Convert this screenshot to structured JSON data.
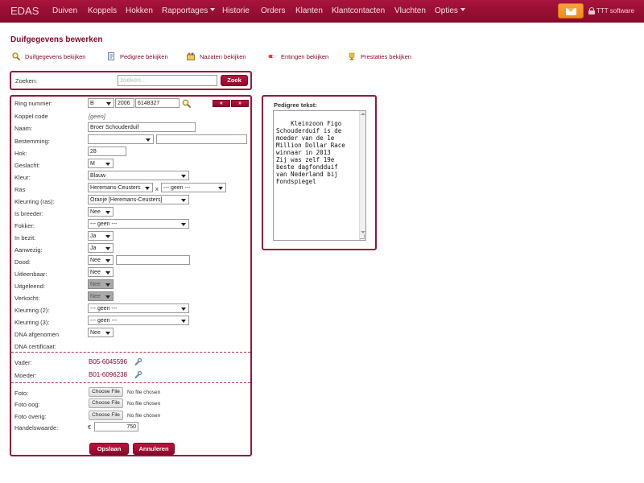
{
  "app": {
    "brand": "EDAS"
  },
  "nav": {
    "items": [
      {
        "label": "Duiven"
      },
      {
        "label": "Koppels"
      },
      {
        "label": "Hokken"
      },
      {
        "label": "Rapportages"
      },
      {
        "label": "Historie"
      },
      {
        "label": "Orders"
      },
      {
        "label": "Klanten"
      },
      {
        "label": "Klantcontacten"
      },
      {
        "label": "Vluchten"
      },
      {
        "label": "Opties"
      }
    ],
    "user": "TTT software"
  },
  "page": {
    "title": "Duifgegevens bewerken",
    "actions": [
      {
        "label": "Duifgegevens bekijken",
        "icon": "magnifier-icon"
      },
      {
        "label": "Pedigree bekijken",
        "icon": "document-icon"
      },
      {
        "label": "Nazaten bekijken",
        "icon": "family-icon"
      },
      {
        "label": "Entingen bekijken",
        "icon": "pill-icon"
      },
      {
        "label": "Prestaties bekijken",
        "icon": "trophy-icon"
      }
    ]
  },
  "search": {
    "label": "Zoeken:",
    "placeholder": "zoeken...",
    "button": "Zoek"
  },
  "form": {
    "ring": {
      "label": "Ring nummer:",
      "country": "B",
      "year": "2006",
      "number": "6148327",
      "prev": "«",
      "next": "»"
    },
    "koppel": {
      "label": "Koppel code",
      "value": "[geen]"
    },
    "naam": {
      "label": "Naam:",
      "value": "Broer Schouderduif"
    },
    "bestemming": {
      "label": "Bestemming:",
      "value": "",
      "extra": ""
    },
    "hok": {
      "label": "Hok:",
      "value": "28"
    },
    "geslacht": {
      "label": "Geslacht:",
      "value": "M"
    },
    "kleur": {
      "label": "Kleur:",
      "value": "Blauw"
    },
    "ras": {
      "label": "Ras",
      "value": "Heremans-Ceusters",
      "sep": "x",
      "value2": "--- geen ---"
    },
    "kleurring_ras": {
      "label": "Kleurring (ras):",
      "value": "Oranje [Heremans-Ceusters]"
    },
    "is_breeder": {
      "label": "Is breeder:",
      "value": "Nee"
    },
    "fokker": {
      "label": "Fokker:",
      "value": "--- geen ---"
    },
    "in_bezit": {
      "label": "In bezit:",
      "value": "Ja"
    },
    "aanwezig": {
      "label": "Aanwezig:",
      "value": "Ja"
    },
    "dood": {
      "label": "Dood:",
      "value": "Nee",
      "extra": ""
    },
    "uitleenbaar": {
      "label": "Uitleenbaar:",
      "value": "Nee"
    },
    "uitgeleend": {
      "label": "Uitgeleend:",
      "value": "Nee"
    },
    "verkocht": {
      "label": "Verkocht:",
      "value": "Nee"
    },
    "kleurring2": {
      "label": "Kleurring (2):",
      "value": "--- geen ---"
    },
    "kleurring3": {
      "label": "Kleurring (3):",
      "value": "--- geen ---"
    },
    "dna": {
      "label": "DNA afgenomen",
      "value": "Nee"
    },
    "dna_cert": {
      "label": "DNA certificaat:"
    },
    "vader": {
      "label": "Vader:",
      "value": "B05-6045596"
    },
    "moeder": {
      "label": "Moeder:",
      "value": "B01-6096238"
    },
    "foto": {
      "label": "Foto:",
      "button": "Choose File",
      "status": "No file chosen"
    },
    "foto_oog": {
      "label": "Foto oog:",
      "button": "Choose File",
      "status": "No file chosen"
    },
    "foto_overig": {
      "label": "Foto overig:",
      "button": "Choose File",
      "status": "No file chosen"
    },
    "handelswaarde": {
      "label": "Handelswaarde:",
      "currency": "€",
      "value": "750"
    },
    "save": "Opslaan",
    "cancel": "Annuleren"
  },
  "pedigree": {
    "label": "Pedigree tekst:",
    "text": "Kleinzoon Figo\nSchouderduif is de\nmoeder van de 1e\nMillion Dollar Race\nwinnaar in 2013\nZij was zelf 19e\nbeste dagfondduif\nvan Nederland bij\nFondspiegel"
  },
  "colors": {
    "brand": "#9a1638",
    "accent": "#f08a1a"
  }
}
